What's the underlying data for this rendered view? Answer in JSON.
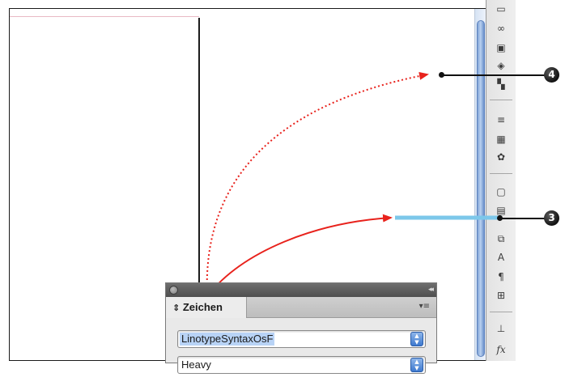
{
  "panel": {
    "tab_label": "Zeichen",
    "tab_prefix_icon": "⇕",
    "menu_icon": "▾≡",
    "collapse_icon": "◂◂",
    "font_family": "LinotypeSyntaxOsF",
    "font_style": "Heavy"
  },
  "callouts": [
    {
      "number": "4"
    },
    {
      "number": "3"
    }
  ],
  "dock_icons": [
    "pages-icon",
    "links-icon",
    "stroke-icon",
    "layers-icon",
    "text-wrap-icon",
    "lines-icon",
    "swatches-icon",
    "color-icon",
    "frame-icon",
    "object-styles-icon",
    "transform-icon",
    "character-icon",
    "paragraph-icon",
    "table-icon",
    "align-icon",
    "formula-icon"
  ],
  "colors": {
    "arrow_red": "#e8221c",
    "highlight_cyan": "#7cc7ea",
    "scroll_blue": "#7fa3d6"
  }
}
